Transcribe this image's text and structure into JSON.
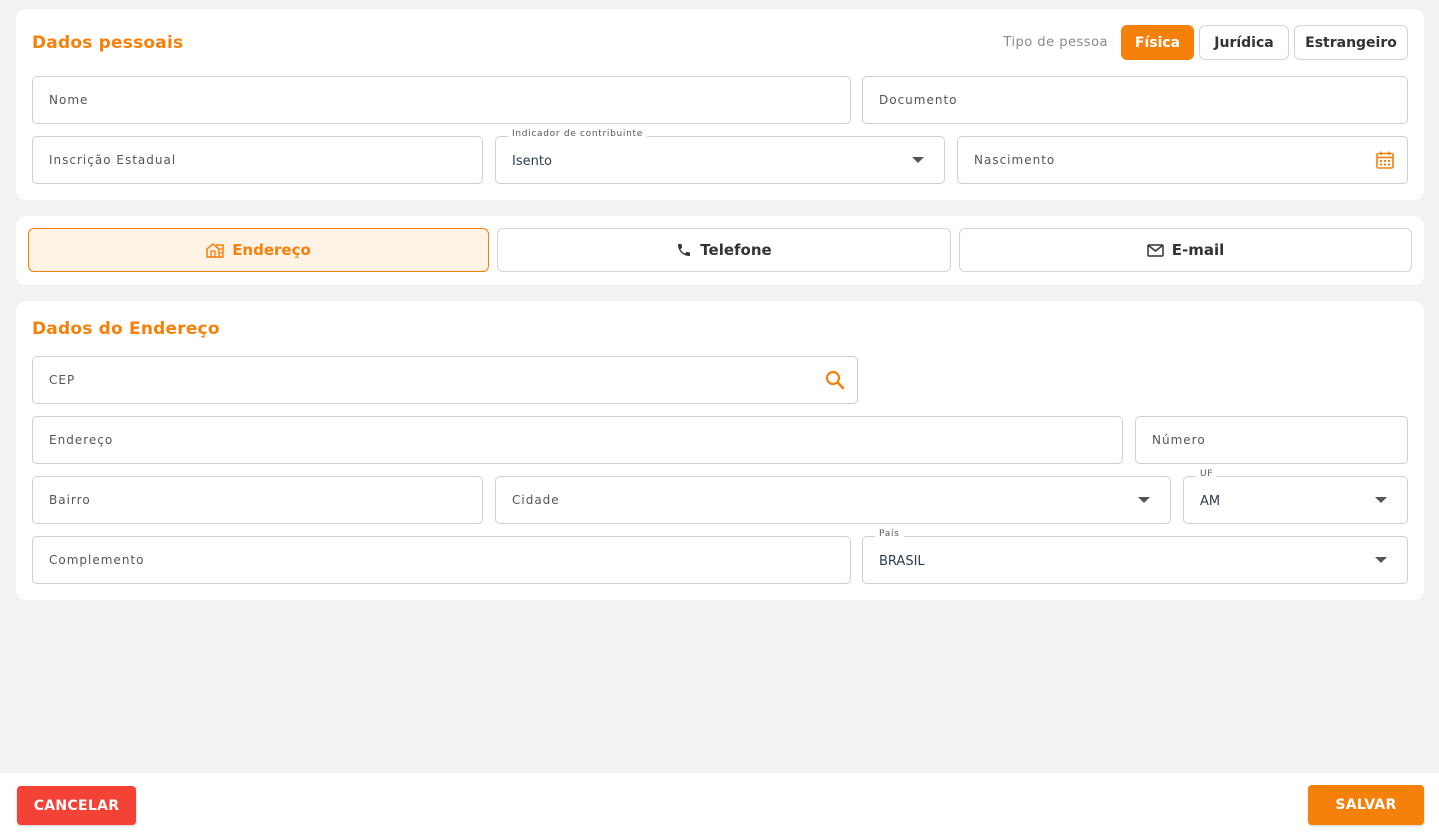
{
  "personal": {
    "title": "Dados pessoais",
    "person_type_label": "Tipo de pessoa",
    "person_types": [
      "Física",
      "Jurídica",
      "Estrangeiro"
    ],
    "selected_person_type": "Física",
    "fields": {
      "nome": "Nome",
      "documento": "Documento",
      "inscricao": "Inscrição Estadual",
      "indicador_label": "Indicador de contribuinte",
      "indicador_value": "Isento",
      "nascimento": "Nascimento"
    }
  },
  "tabs": [
    {
      "label": "Endereço",
      "icon": "house-icon",
      "active": true
    },
    {
      "label": "Telefone",
      "icon": "phone-icon",
      "active": false
    },
    {
      "label": "E-mail",
      "icon": "mail-icon",
      "active": false
    }
  ],
  "address": {
    "title": "Dados do Endereço",
    "fields": {
      "cep": "CEP",
      "endereco": "Endereço",
      "numero": "Número",
      "bairro": "Bairro",
      "cidade": "Cidade",
      "uf_label": "UF",
      "uf_value": "AM",
      "complemento": "Complemento",
      "pais_label": "País",
      "pais_value": "BRASIL"
    }
  },
  "footer": {
    "cancel_label": "CANCELAR",
    "save_label": "SALVAR"
  },
  "colors": {
    "accent": "#f5800a",
    "danger": "#f44336",
    "background": "#f2f2f2"
  }
}
